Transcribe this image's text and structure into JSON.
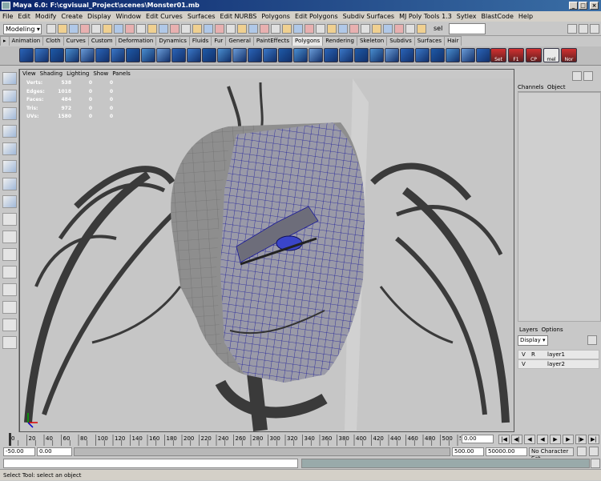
{
  "title": "Maya 6.0: F:\\cgvisual_Project\\scenes\\Monster01.mb",
  "menu": [
    "File",
    "Edit",
    "Modify",
    "Create",
    "Display",
    "Window",
    "Edit Curves",
    "Surfaces",
    "Edit NURBS",
    "Polygons",
    "Edit Polygons",
    "Subdiv Surfaces",
    "MJ Poly Tools 1.3",
    "Sytlex",
    "BlastCode",
    "Help"
  ],
  "status": {
    "mode": "Modeling",
    "sel_label": "sel"
  },
  "shelf_tabs": [
    "Animation",
    "Cloth",
    "Curves",
    "Custom",
    "Deformation",
    "Dynamics",
    "Fluids",
    "Fur",
    "General",
    "PaintEffects",
    "Polygons",
    "Rendering",
    "Skeleton",
    "Subdivs",
    "Surfaces",
    "Hair"
  ],
  "active_shelf": "Polygons",
  "shelf_labels": [
    "Set",
    "F1",
    "CP",
    "mel button",
    "Nor"
  ],
  "panel_menu": [
    "View",
    "Shading",
    "Lighting",
    "Show",
    "Panels"
  ],
  "hud": [
    {
      "k": "Verts:",
      "a": "538",
      "b": "0",
      "c": "0"
    },
    {
      "k": "Edges:",
      "a": "1018",
      "b": "0",
      "c": "0"
    },
    {
      "k": "Faces:",
      "a": "484",
      "b": "0",
      "c": "0"
    },
    {
      "k": "Tris:",
      "a": "972",
      "b": "0",
      "c": "0"
    },
    {
      "k": "UVs:",
      "a": "1580",
      "b": "0",
      "c": "0"
    }
  ],
  "channel_box": {
    "tab1": "Channels",
    "tab2": "Object"
  },
  "layers": {
    "tab1": "Layers",
    "tab2": "Options",
    "display": "Display",
    "rows": [
      {
        "v": "V",
        "r": "R",
        "name": "layer1"
      },
      {
        "v": "V",
        "r": "",
        "name": "layer2"
      }
    ]
  },
  "timeline": {
    "ticks": [
      "0",
      "20",
      "40",
      "60",
      "80",
      "100",
      "120",
      "140",
      "160",
      "180",
      "200",
      "220",
      "240",
      "260",
      "280",
      "300",
      "320",
      "340",
      "360",
      "380",
      "400",
      "420",
      "440",
      "460",
      "480",
      "500",
      "520"
    ],
    "current": "0.00"
  },
  "range": {
    "start": "-50.00",
    "start2": "0.00",
    "end": "500.00",
    "end2": "50000.00",
    "charset": "No Character Set"
  },
  "help": "Select Tool: select an object"
}
